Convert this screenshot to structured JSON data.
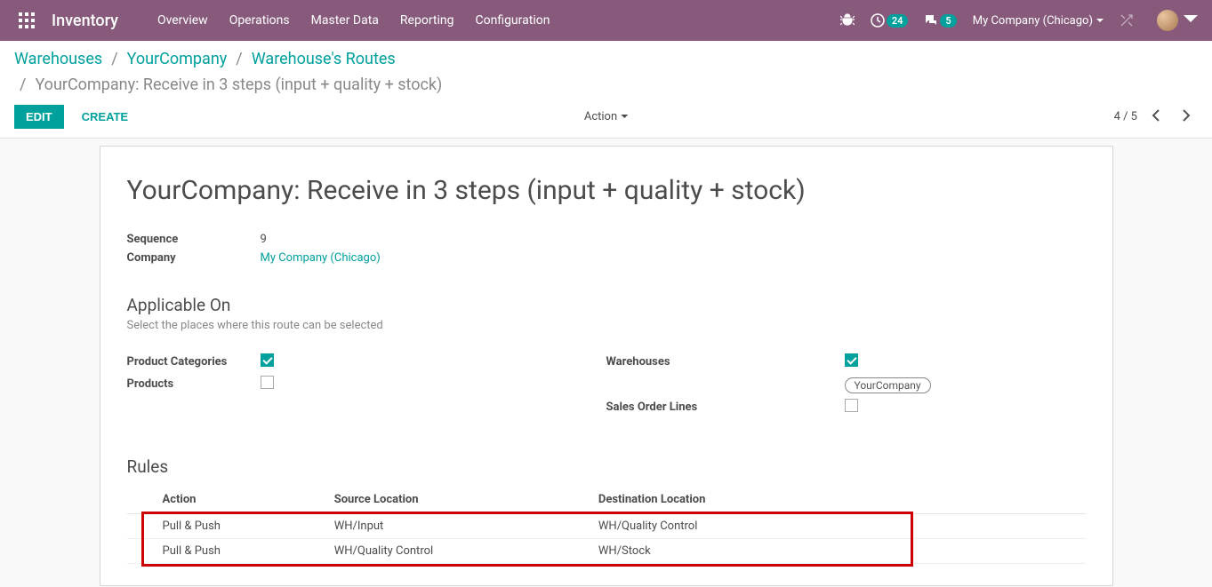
{
  "navbar": {
    "brand": "Inventory",
    "menu": [
      "Overview",
      "Operations",
      "Master Data",
      "Reporting",
      "Configuration"
    ],
    "activity_badge": "24",
    "discuss_badge": "5",
    "company": "My Company (Chicago)"
  },
  "breadcrumb": {
    "parts": [
      "Warehouses",
      "YourCompany",
      "Warehouse's Routes"
    ],
    "current": "YourCompany: Receive in 3 steps (input + quality + stock)"
  },
  "cp": {
    "edit": "EDIT",
    "create": "CREATE",
    "action": "Action",
    "pager": "4 / 5"
  },
  "form": {
    "title": "YourCompany: Receive in 3 steps (input + quality + stock)",
    "labels": {
      "sequence": "Sequence",
      "company": "Company",
      "applicable_on": "Applicable On",
      "applicable_on_sub": "Select the places where this route can be selected",
      "product_categories": "Product Categories",
      "products": "Products",
      "warehouses": "Warehouses",
      "sales_order_lines": "Sales Order Lines",
      "rules": "Rules"
    },
    "values": {
      "sequence": "9",
      "company": "My Company (Chicago)",
      "warehouse_tag": "YourCompany"
    },
    "checks": {
      "product_categories": true,
      "products": false,
      "warehouses": true,
      "sales_order_lines": false
    },
    "rules_headers": {
      "action": "Action",
      "source": "Source Location",
      "destination": "Destination Location"
    },
    "rules": [
      {
        "action": "Pull & Push",
        "source": "WH/Input",
        "destination": "WH/Quality Control"
      },
      {
        "action": "Pull & Push",
        "source": "WH/Quality Control",
        "destination": "WH/Stock"
      }
    ]
  }
}
